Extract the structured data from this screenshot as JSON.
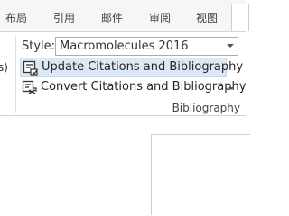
{
  "tabs": [
    {
      "label": "布局"
    },
    {
      "label": "引用"
    },
    {
      "label": "邮件"
    },
    {
      "label": "审阅"
    },
    {
      "label": "视图"
    },
    {
      "label": ""
    }
  ],
  "ribbon": {
    "left_edge_text": "s)",
    "style_label": "Style:",
    "style_value": "Macromolecules 2016",
    "update_label": "Update Citations and Bibliography",
    "convert_label": "Convert Citations and Bibliography",
    "group_label": "Bibliography"
  },
  "icons": {
    "update": "update-citations-icon",
    "convert": "convert-citations-icon",
    "dropdown": "chevron-down-icon"
  },
  "colors": {
    "hover_background": "#dce8f6",
    "icon_dark": "#333333"
  }
}
